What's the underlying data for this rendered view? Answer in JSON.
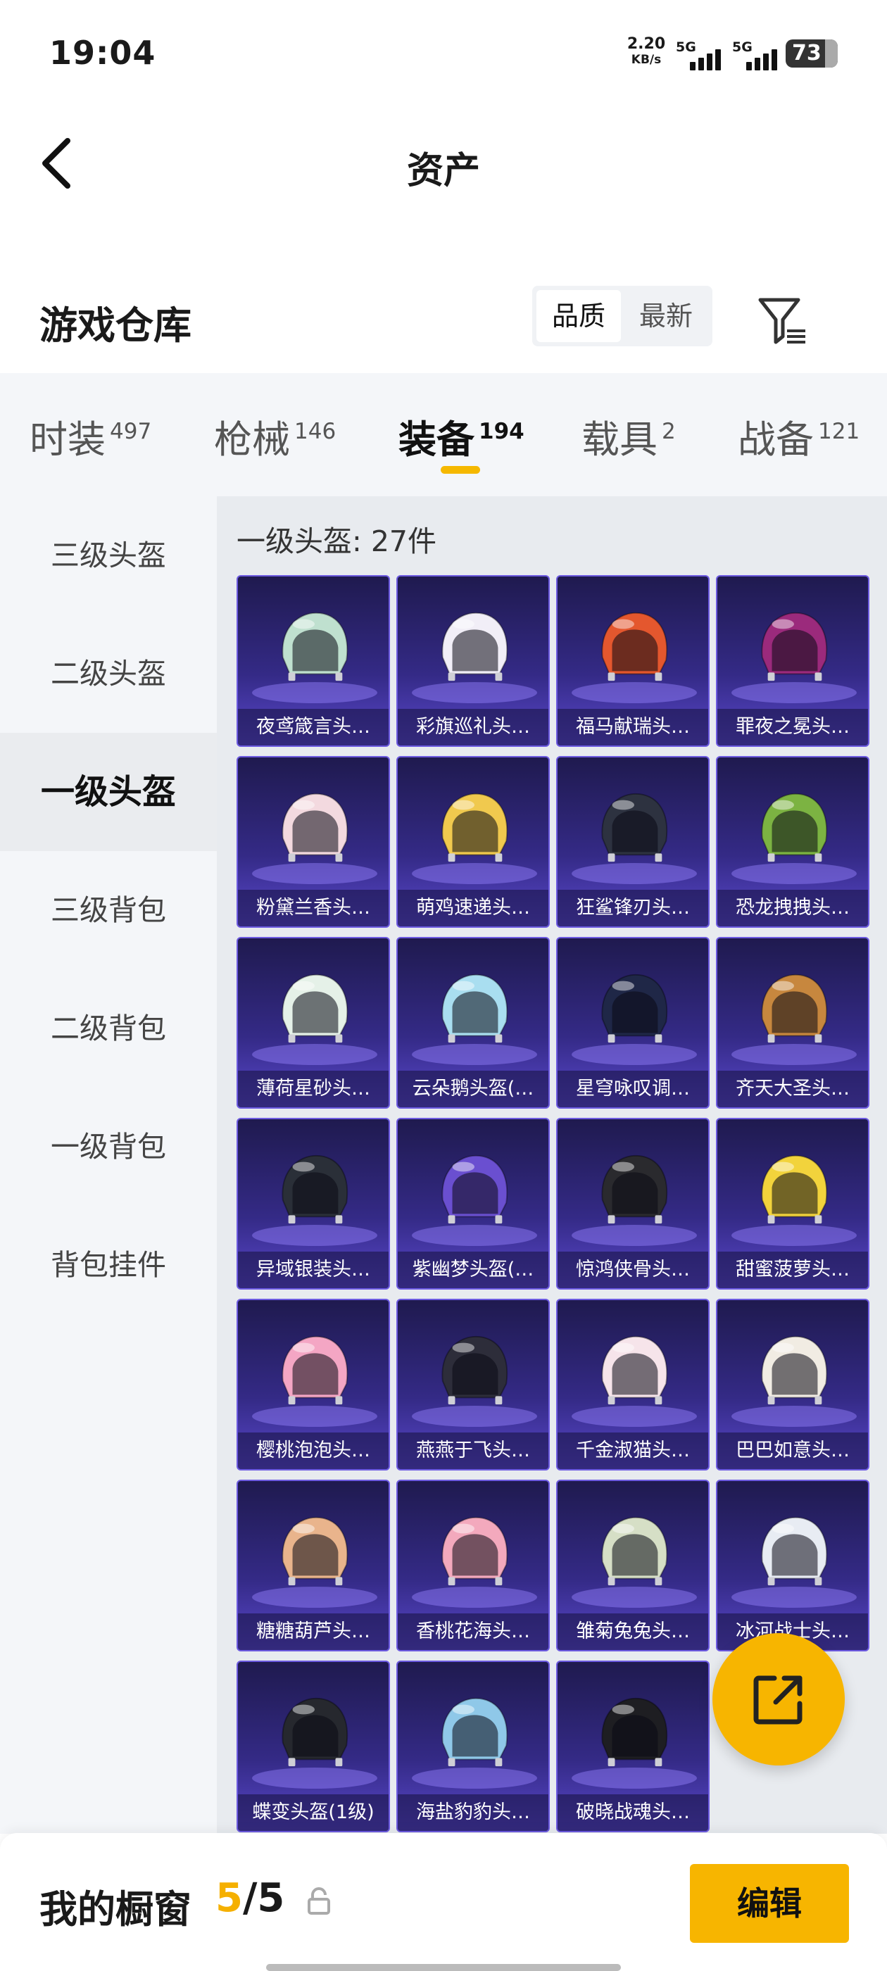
{
  "status_bar": {
    "time": "19:04",
    "net_speed": "2.20",
    "net_unit": "KB/s",
    "sim1": "5G",
    "sim2": "5G",
    "battery": "73"
  },
  "header": {
    "title": "资产"
  },
  "warehouse": {
    "title": "游戏仓库",
    "sort_options": [
      "品质",
      "最新"
    ],
    "active_sort": "品质"
  },
  "tabs": [
    {
      "label": "时装",
      "count": "497"
    },
    {
      "label": "枪械",
      "count": "146"
    },
    {
      "label": "装备",
      "count": "194"
    },
    {
      "label": "载具",
      "count": "2"
    },
    {
      "label": "战备",
      "count": "121"
    }
  ],
  "active_tab": "装备",
  "sidebar": {
    "items": [
      "三级头盔",
      "二级头盔",
      "一级头盔",
      "三级背包",
      "二级背包",
      "一级背包",
      "背包挂件"
    ],
    "active": "一级头盔"
  },
  "content": {
    "count_label": "一级头盔: 27件"
  },
  "items": [
    {
      "name": "夜鸢箴言头…",
      "color": "#bfe0cf"
    },
    {
      "name": "彩旗巡礼头…",
      "color": "#f1eef7"
    },
    {
      "name": "福马献瑞头…",
      "color": "#e4572e"
    },
    {
      "name": "罪夜之冕头…",
      "color": "#9b2a7c"
    },
    {
      "name": "粉黛兰香头…",
      "color": "#f3d9df"
    },
    {
      "name": "萌鸡速递头…",
      "color": "#f0c94e"
    },
    {
      "name": "狂鲨锋刃头…",
      "color": "#2d3240"
    },
    {
      "name": "恐龙拽拽头…",
      "color": "#7cb342"
    },
    {
      "name": "薄荷星砂头…",
      "color": "#e5f1e8"
    },
    {
      "name": "云朵鹅头盔(…",
      "color": "#a9def0"
    },
    {
      "name": "星穹咏叹调…",
      "color": "#1f2747"
    },
    {
      "name": "齐天大圣头…",
      "color": "#c7873e"
    },
    {
      "name": "异域银装头…",
      "color": "#2a2f38"
    },
    {
      "name": "紫幽梦头盔(…",
      "color": "#6a4fd0"
    },
    {
      "name": "惊鸿侠骨头…",
      "color": "#2a2a2e"
    },
    {
      "name": "甜蜜菠萝头…",
      "color": "#f2d33c"
    },
    {
      "name": "樱桃泡泡头…",
      "color": "#f4a6c4"
    },
    {
      "name": "燕燕于飞头…",
      "color": "#2d2d3a"
    },
    {
      "name": "千金淑猫头…",
      "color": "#f6e4ea"
    },
    {
      "name": "巴巴如意头…",
      "color": "#f1ece3"
    },
    {
      "name": "糖糖葫芦头…",
      "color": "#e9b48c"
    },
    {
      "name": "香桃花海头…",
      "color": "#f3a9bd"
    },
    {
      "name": "雏菊兔兔头…",
      "color": "#d6dfc6"
    },
    {
      "name": "冰河战士头…",
      "color": "#e8ecf3"
    },
    {
      "name": "蝶变头盔(1级)",
      "color": "#26282e"
    },
    {
      "name": "海盐豹豹头…",
      "color": "#8fc8e8"
    },
    {
      "name": "破晓战魂头…",
      "color": "#1e1e22"
    }
  ],
  "showcase": {
    "title": "我的橱窗",
    "current": "5",
    "total": "/5",
    "edit_label": "编辑"
  }
}
